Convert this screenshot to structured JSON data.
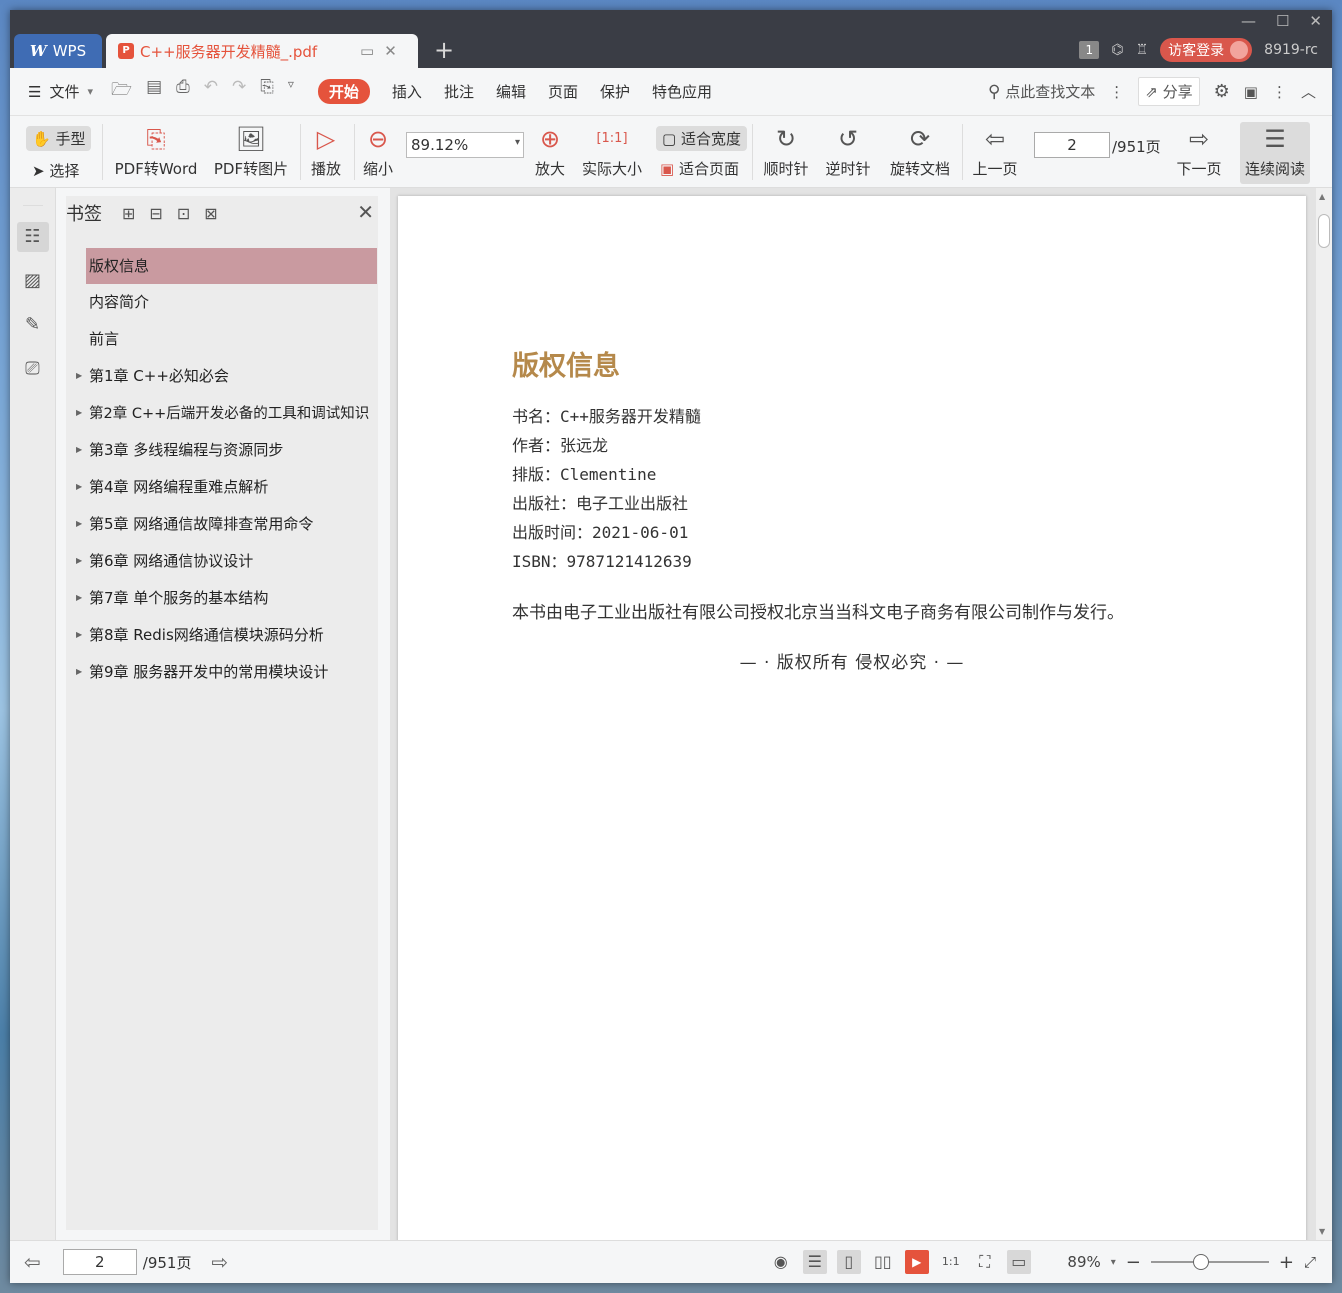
{
  "titlebar": {
    "app_tab": "WPS",
    "doc_tab": "C++服务器开发精髓_.pdf",
    "badge_num": "1",
    "guest_login": "访客登录",
    "user_id": "8919-rc"
  },
  "menubar": {
    "file": "文件",
    "tabs": [
      "开始",
      "插入",
      "批注",
      "编辑",
      "页面",
      "保护",
      "特色应用"
    ],
    "search": "点此查找文本",
    "share": "分享"
  },
  "toolbar": {
    "hand": "手型",
    "select": "选择",
    "pdf_to_word": "PDF转Word",
    "pdf_to_image": "PDF转图片",
    "play": "播放",
    "zoom_out": "缩小",
    "zoom_value": "89.12%",
    "zoom_in": "放大",
    "actual_size": "实际大小",
    "fit_width": "适合宽度",
    "fit_page": "适合页面",
    "clockwise": "顺时针",
    "counterclockwise": "逆时针",
    "rotate_doc": "旋转文档",
    "prev_page": "上一页",
    "page_current": "2",
    "page_total": "/951页",
    "next_page": "下一页",
    "continuous_read": "连续阅读"
  },
  "bookmarks": {
    "title": "书签",
    "items": [
      {
        "label": "版权信息",
        "expandable": false
      },
      {
        "label": "内容简介",
        "expandable": false
      },
      {
        "label": "前言",
        "expandable": false
      },
      {
        "label": "第1章 C++必知必会",
        "expandable": true
      },
      {
        "label": "第2章 C++后端开发必备的工具和调试知识",
        "expandable": true
      },
      {
        "label": "第3章 多线程编程与资源同步",
        "expandable": true
      },
      {
        "label": "第4章 网络编程重难点解析",
        "expandable": true
      },
      {
        "label": "第5章 网络通信故障排查常用命令",
        "expandable": true
      },
      {
        "label": "第6章 网络通信协议设计",
        "expandable": true
      },
      {
        "label": "第7章 单个服务的基本结构",
        "expandable": true
      },
      {
        "label": "第8章 Redis网络通信模块源码分析",
        "expandable": true
      },
      {
        "label": "第9章 服务器开发中的常用模块设计",
        "expandable": true
      }
    ]
  },
  "document": {
    "heading": "版权信息",
    "lines": [
      "书名：C++服务器开发精髓",
      "作者：张远龙",
      "排版：Clementine",
      "出版社：电子工业出版社",
      "出版时间：2021-06-01",
      "ISBN：9787121412639"
    ],
    "statement": "本书由电子工业出版社有限公司授权北京当当科文电子商务有限公司制作与发行。",
    "copyright": "— · 版权所有 侵权必究 · —"
  },
  "statusbar": {
    "page_current": "2",
    "page_total": "/951页",
    "zoom": "89%"
  },
  "colors": {
    "accent": "#e5533c",
    "titlebar": "#3a3d45",
    "heading": "#b5894b",
    "bookmark_selected": "#c99aa0"
  }
}
